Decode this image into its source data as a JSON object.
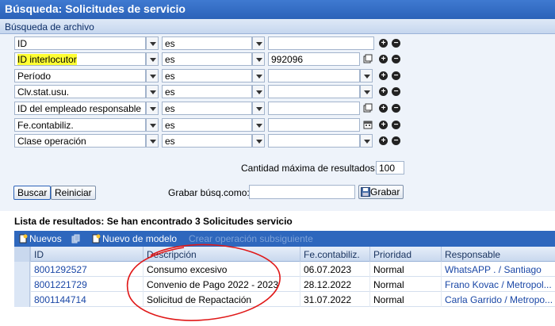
{
  "header": {
    "title": "Búsqueda: Solicitudes de servicio",
    "subtitle": "Búsqueda de archivo"
  },
  "criteria": [
    {
      "field": "ID",
      "operator": "es",
      "value": ""
    },
    {
      "field": "ID interlocutor",
      "operator": "es",
      "value": "992096",
      "highlighted": true
    },
    {
      "field": "Período",
      "operator": "es",
      "value": ""
    },
    {
      "field": "Clv.stat.usu.",
      "operator": "es",
      "value": ""
    },
    {
      "field": "ID del empleado responsable",
      "operator": "es",
      "value": ""
    },
    {
      "field": "Fe.contabiliz.",
      "operator": "es",
      "value": ""
    },
    {
      "field": "Clase operación",
      "operator": "es",
      "value": ""
    }
  ],
  "max_results": {
    "label": "Cantidad máxima de resultados:",
    "value": "100"
  },
  "actions": {
    "search": "Buscar",
    "reset": "Reiniciar",
    "save_as_label": "Grabar búsq.como:",
    "save_button": "Grabar"
  },
  "results": {
    "title": "Lista de resultados: Se han encontrado 3 Solicitudes servicio",
    "toolbar": {
      "new": "Nuevos",
      "new_from_template": "Nuevo de modelo",
      "follow_up": "Crear operación subsiguiente"
    },
    "columns": [
      "ID",
      "Descripción",
      "Fe.contabiliz.",
      "Prioridad",
      "Responsable"
    ],
    "rows": [
      {
        "id": "8001292527",
        "description": "Consumo excesivo",
        "date": "06.07.2023",
        "priority": "Normal",
        "responsible": "WhatsAPP . / Santiago"
      },
      {
        "id": "8001221729",
        "description": "Convenio de Pago 2022 - 2023",
        "date": "28.12.2022",
        "priority": "Normal",
        "responsible": "Frano Kovac / Metropol..."
      },
      {
        "id": "8001144714",
        "description": "Solicitud de Repactación",
        "date": "31.07.2022",
        "priority": "Normal",
        "responsible": "Carla Garrido / Metropo..."
      }
    ]
  },
  "colors": {
    "title_bar": "#2b62b8",
    "highlight": "#ffff33",
    "annotation": "#e01818"
  }
}
